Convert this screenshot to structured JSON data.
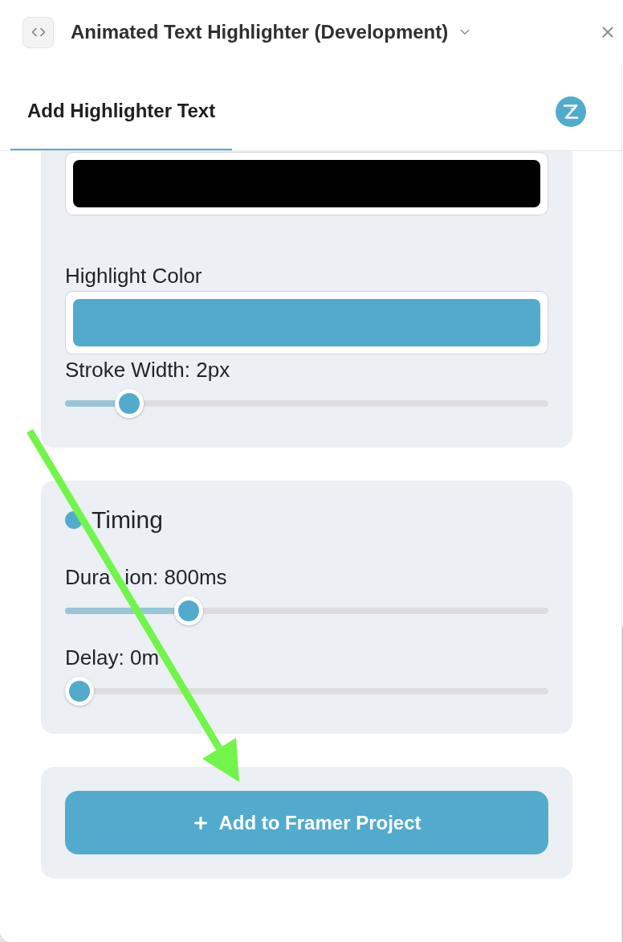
{
  "window": {
    "title": "Animated Text Highlighter (Development)"
  },
  "tabs": [
    {
      "label": "Add Highlighter Text",
      "selected": true
    }
  ],
  "sections": [
    {
      "kind": "style",
      "fields": [
        {
          "kind": "color",
          "color": "#000000"
        },
        {
          "kind": "color",
          "label": "Highlight Color",
          "color": "#52abcd"
        },
        {
          "kind": "slider",
          "label_parts": [
            "Stroke Width: 2px"
          ],
          "level": 0.11
        }
      ]
    },
    {
      "kind": "timing",
      "title": "Timing",
      "fields": [
        {
          "kind": "slider",
          "label_parts": [
            "Dura",
            "ion: 800ms"
          ],
          "level": 0.24
        },
        {
          "kind": "slider",
          "label_parts": [
            "Delay: 0m"
          ],
          "level": 0
        }
      ]
    },
    {
      "kind": "actions",
      "button": {
        "label": "Add to Framer Project"
      }
    }
  ]
}
